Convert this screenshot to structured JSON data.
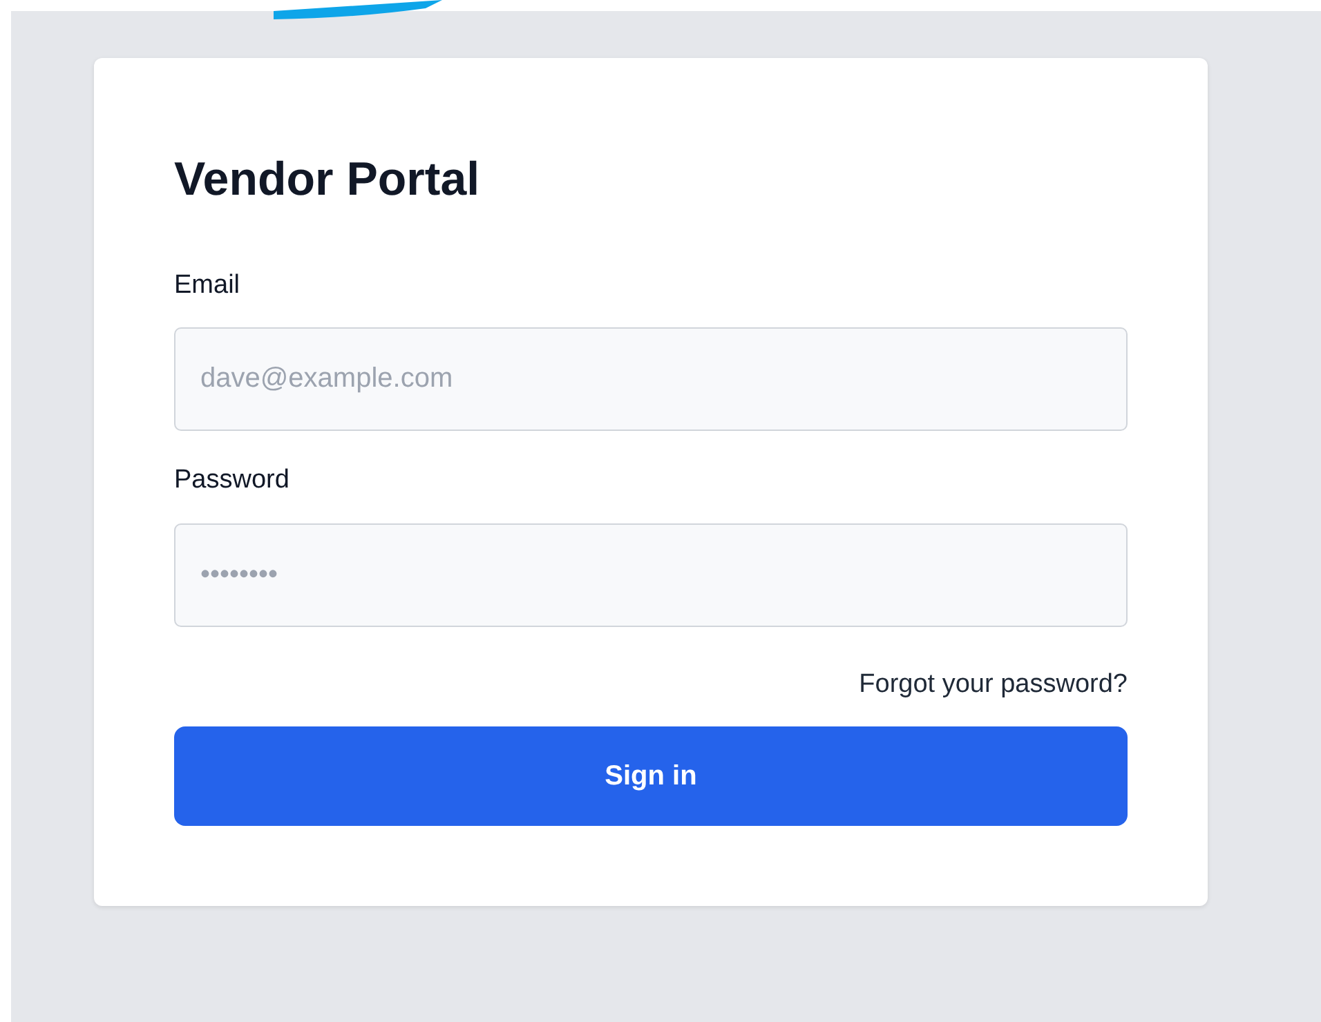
{
  "title": "Vendor Portal",
  "fields": [
    {
      "label": "Email",
      "placeholder": "dave@example.com"
    },
    {
      "label": "Password",
      "placeholder": "••••••••"
    }
  ],
  "forgot_link": "Forgot your password?",
  "submit_button": "Sign in"
}
